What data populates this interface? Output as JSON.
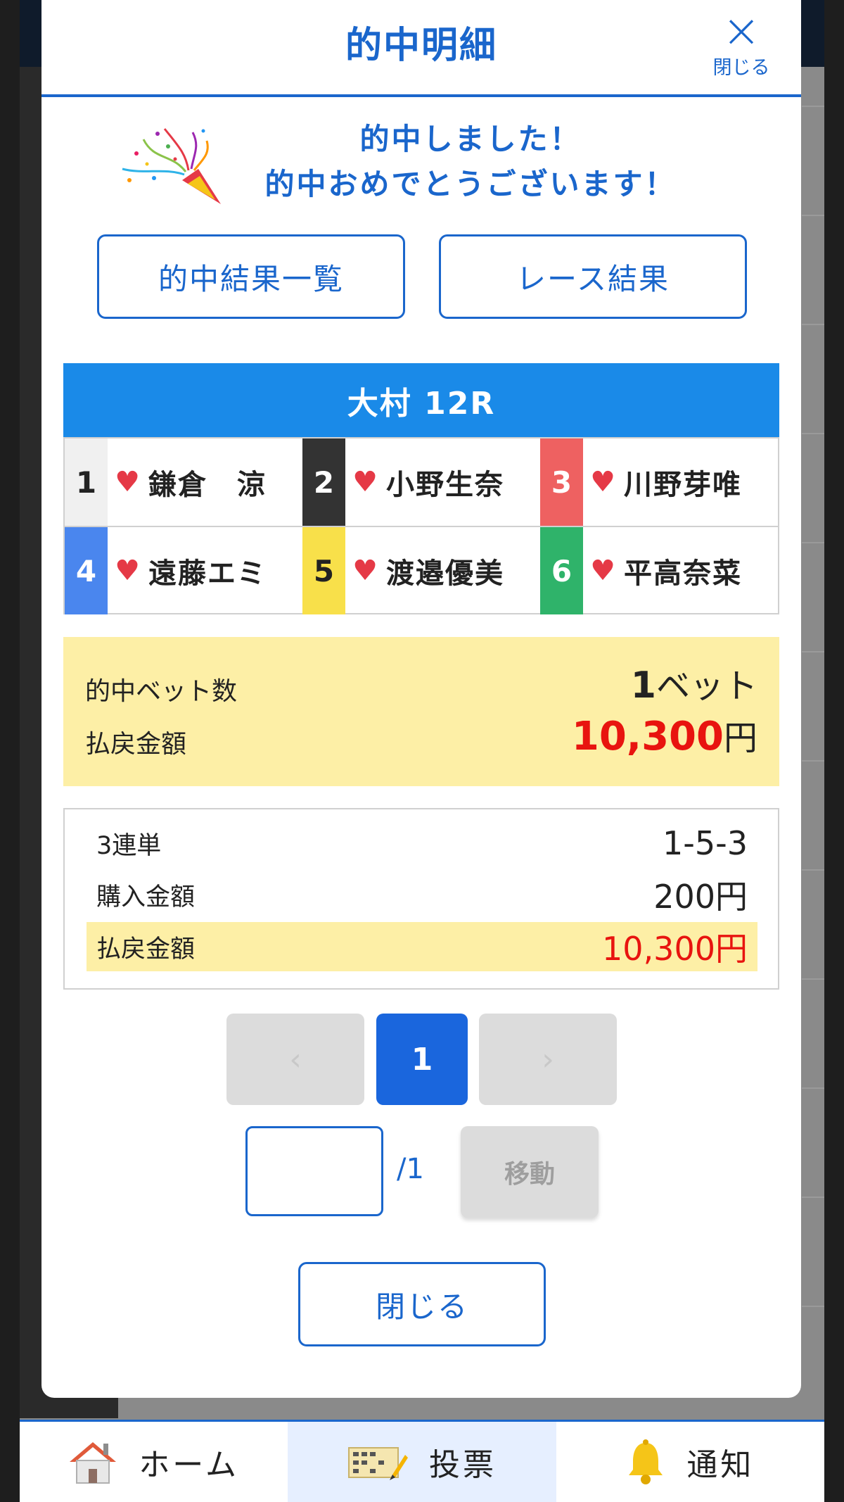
{
  "modal": {
    "title": "的中明細",
    "close_label": "閉じる",
    "close_icon": "×"
  },
  "congrats": {
    "line1": "的中しました！",
    "line2": "的中おめでとうございます！"
  },
  "links": {
    "results_list": "的中結果一覧",
    "race_result": "レース結果"
  },
  "race": {
    "title": "大村 12R",
    "racers": [
      {
        "num": "1",
        "name": "鎌倉　涼",
        "color": "#f0f0f0",
        "text_color": "#222222"
      },
      {
        "num": "2",
        "name": "小野生奈",
        "color": "#333333",
        "text_color": "#ffffff"
      },
      {
        "num": "3",
        "name": "川野芽唯",
        "color": "#ee6161",
        "text_color": "#ffffff"
      },
      {
        "num": "4",
        "name": "遠藤エミ",
        "color": "#4a86ee",
        "text_color": "#ffffff"
      },
      {
        "num": "5",
        "name": "渡邉優美",
        "color": "#f8e04a",
        "text_color": "#222222"
      },
      {
        "num": "6",
        "name": "平高奈菜",
        "color": "#2fb36a",
        "text_color": "#ffffff"
      }
    ],
    "heart": "♥"
  },
  "summary": {
    "bets_label": "的中ベット数",
    "bets_value": "1",
    "bets_unit": "ベット",
    "payout_label": "払戻金額",
    "payout_value": "10,300",
    "payout_unit": "円"
  },
  "detail": {
    "type_label": "3連単",
    "type_value": "1-5-3",
    "purchase_label": "購入金額",
    "purchase_value": "200円",
    "payout_label": "払戻金額",
    "payout_value": "10,300円"
  },
  "pager": {
    "prev": "‹",
    "current": "1",
    "next": "›"
  },
  "jump": {
    "input_value": "",
    "total": "/1",
    "button": "移動"
  },
  "close_button": "閉じる",
  "nav": {
    "home": "ホーム",
    "vote": "投票",
    "notify": "通知"
  },
  "colors": {
    "accent": "#1a66cc",
    "race_header": "#1a8ae8",
    "highlight": "#fdefa6",
    "payout_red": "#e8140f"
  }
}
